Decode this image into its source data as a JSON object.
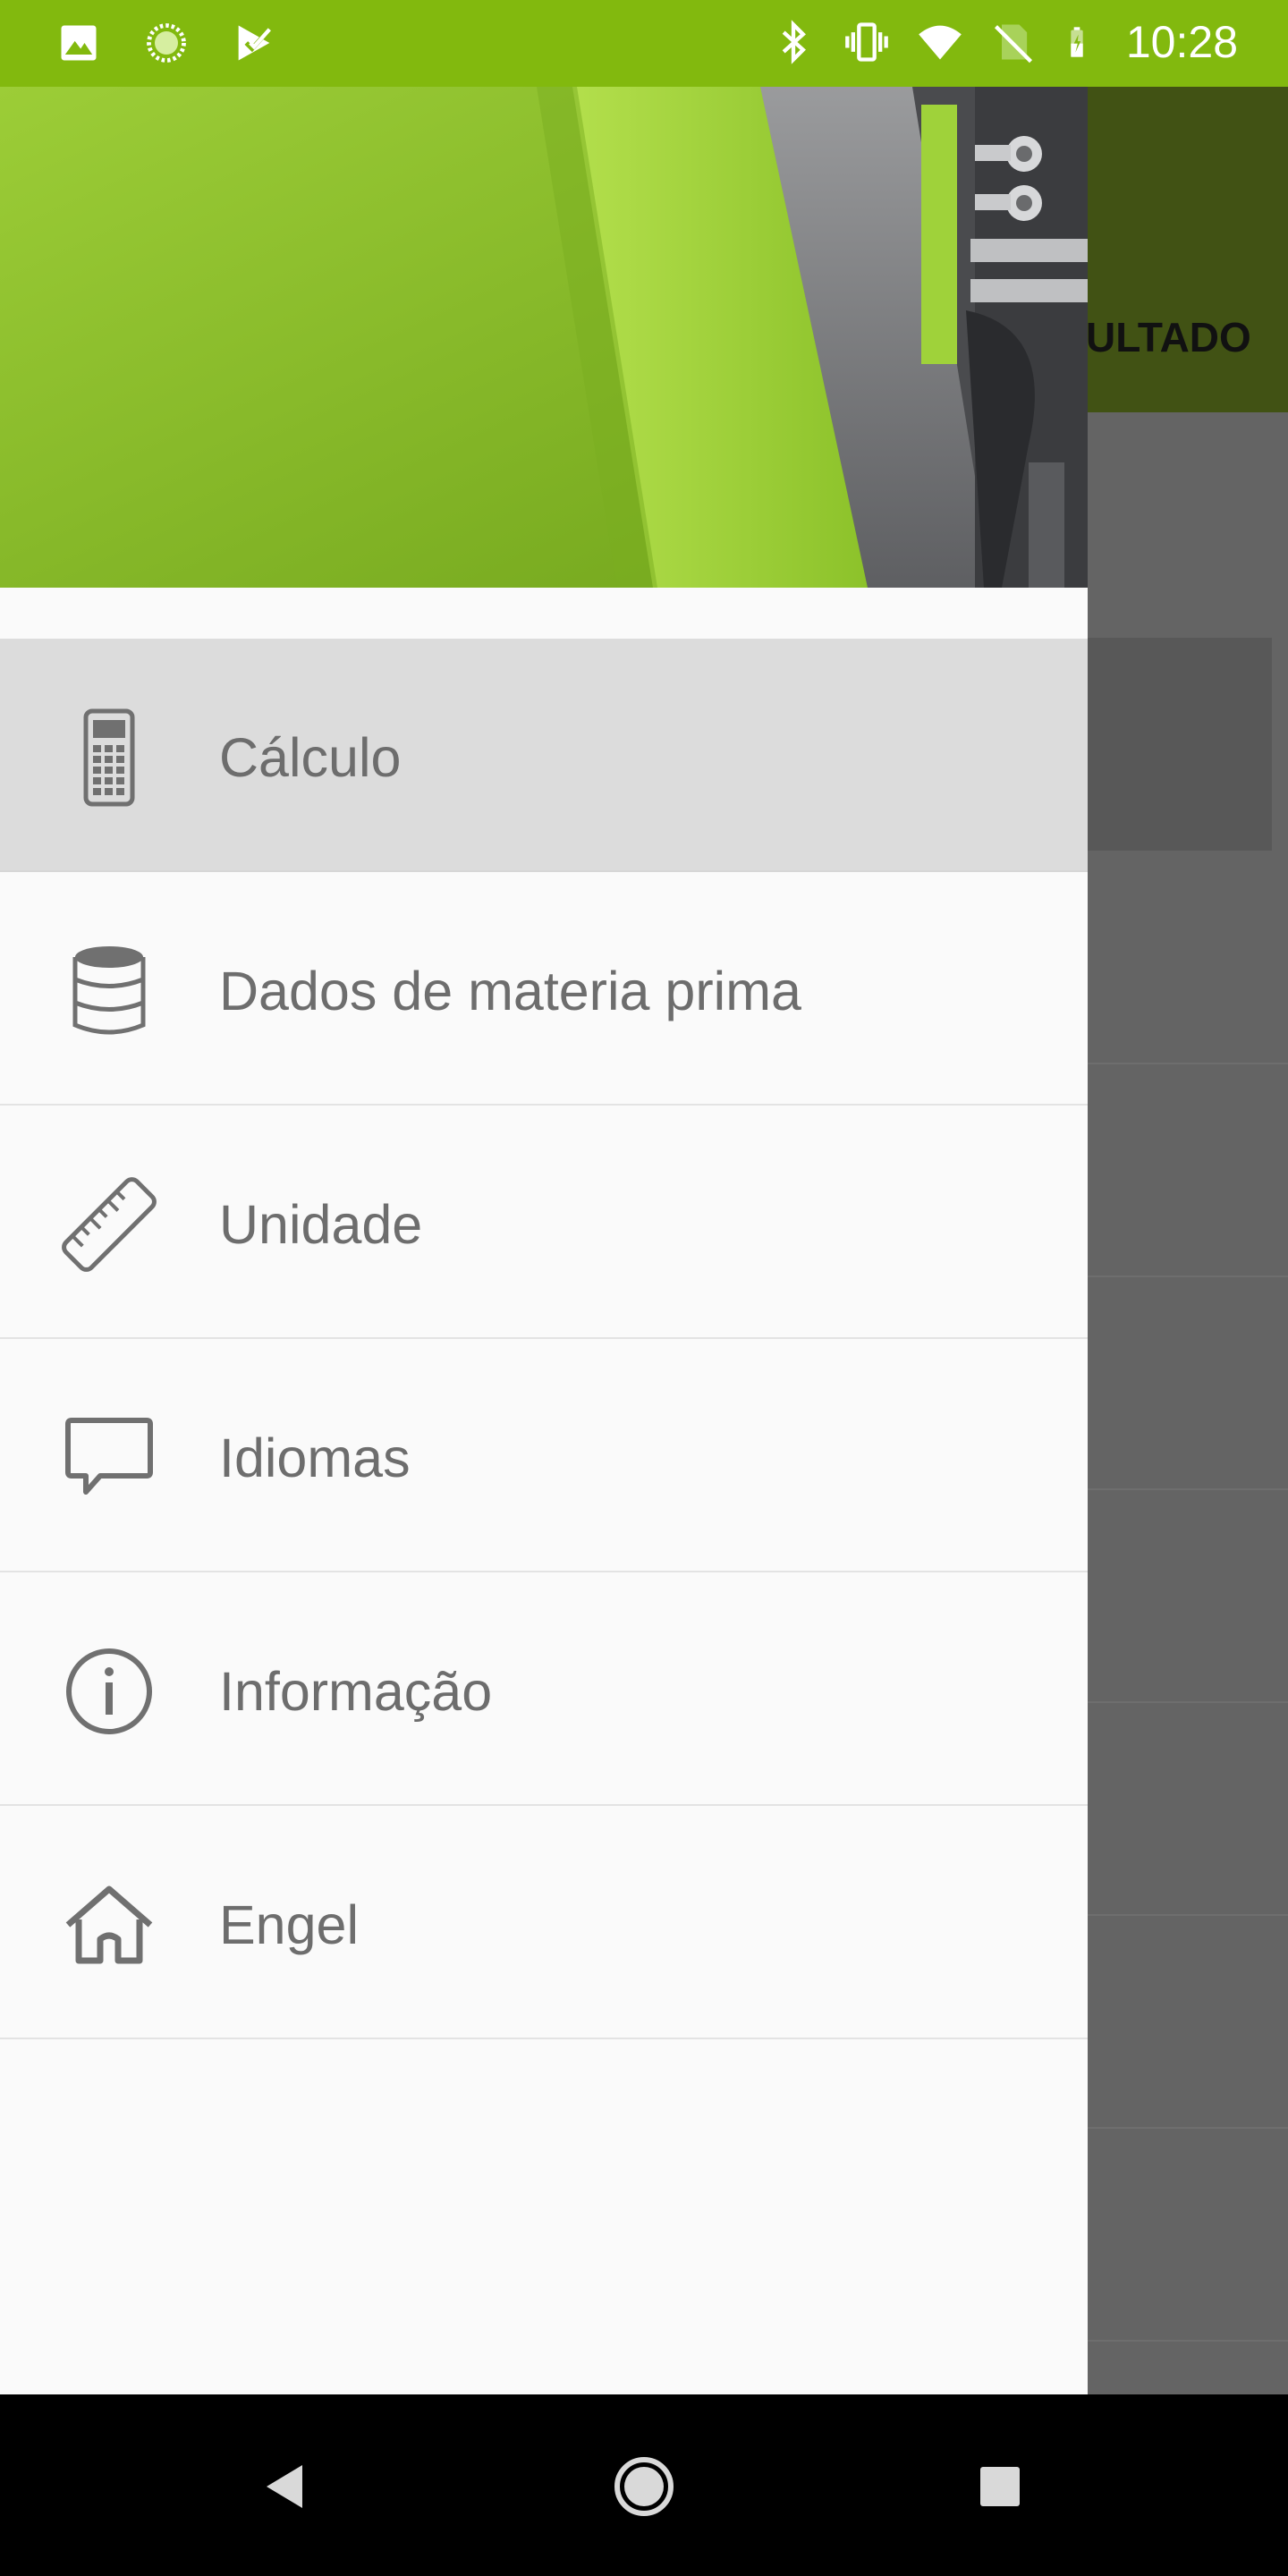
{
  "status_bar": {
    "time": "10:28",
    "left_icons": [
      "image-icon",
      "loading-icon",
      "task-check-icon"
    ],
    "right_icons": [
      "bluetooth-icon",
      "vibrate-icon",
      "wifi-icon",
      "no-sim-icon",
      "battery-charging-icon"
    ]
  },
  "underlying_app": {
    "tab_label": "ULTADO"
  },
  "drawer": {
    "header_image": "machine-header-image",
    "items": [
      {
        "label": "Cálculo",
        "icon": "calculator-icon",
        "active": true
      },
      {
        "label": "Dados de materia prima",
        "icon": "database-icon",
        "active": false
      },
      {
        "label": "Unidade",
        "icon": "ruler-icon",
        "active": false
      },
      {
        "label": "Idiomas",
        "icon": "chat-bubble-icon",
        "active": false
      },
      {
        "label": "Informação",
        "icon": "info-icon",
        "active": false
      },
      {
        "label": "Engel",
        "icon": "home-icon",
        "active": false
      }
    ]
  },
  "nav_bar": {
    "buttons": [
      "back-button",
      "home-button",
      "recents-button"
    ]
  },
  "colors": {
    "status_bar": "#82b90e",
    "header_green": "#a3d13d",
    "scrim": "#646464",
    "active_item": "#dcdcdc",
    "label_text": "#6d6d6d",
    "icon_stroke": "#707070"
  }
}
